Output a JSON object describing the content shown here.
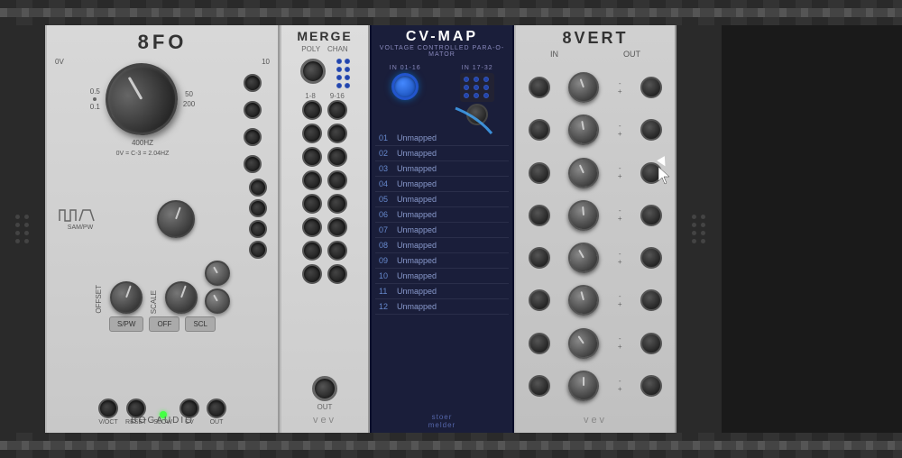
{
  "rack": {
    "background": "#1a1a1a"
  },
  "module_8fo": {
    "title": "8FO",
    "brand": "BOGAUDIO",
    "freq_labels": {
      "top_left": "0V",
      "top_right": "10",
      "mid_right": "50",
      "bottom_left": "0.5",
      "bottom_right": "200",
      "hz_label": "400HZ",
      "left_label": "0.1",
      "cv_label": "0V = C-3 = 2.04HZ"
    },
    "section_labels": {
      "offset": "OFFSET",
      "scale": "SCALE",
      "sampw": "SAM/PW"
    },
    "buttons": [
      "S/PW",
      "OFF",
      "SCL"
    ],
    "bottom_labels": [
      "V/OCT",
      "RESET",
      "SLOW",
      "CV",
      "OUT"
    ]
  },
  "module_merge": {
    "title": "MERGE",
    "labels": [
      "POLY",
      "CHAN"
    ],
    "section_labels": [
      "1-8",
      "9-16"
    ],
    "brand": "vev"
  },
  "module_cvmap": {
    "title": "CV-MAP",
    "subtitle": "VOLTAGE CONTROLLED PARA-O-MATOR",
    "input_labels": [
      "IN 01-16",
      "IN 17-32"
    ],
    "map_items": [
      {
        "num": "01",
        "label": "Unmapped"
      },
      {
        "num": "02",
        "label": "Unmapped"
      },
      {
        "num": "03",
        "label": "Unmapped"
      },
      {
        "num": "04",
        "label": "Unmapped"
      },
      {
        "num": "05",
        "label": "Unmapped"
      },
      {
        "num": "06",
        "label": "Unmapped"
      },
      {
        "num": "07",
        "label": "Unmapped"
      },
      {
        "num": "08",
        "label": "Unmapped"
      },
      {
        "num": "09",
        "label": "Unmapped"
      },
      {
        "num": "10",
        "label": "Unmapped"
      },
      {
        "num": "11",
        "label": "Unmapped"
      },
      {
        "num": "12",
        "label": "Unmapped"
      }
    ],
    "brand_line1": "stoer",
    "brand_line2": "melder"
  },
  "module_8vert": {
    "title": "8VERT",
    "io_labels": [
      "IN",
      "OUT"
    ],
    "brand": "vev",
    "rows": 8
  }
}
